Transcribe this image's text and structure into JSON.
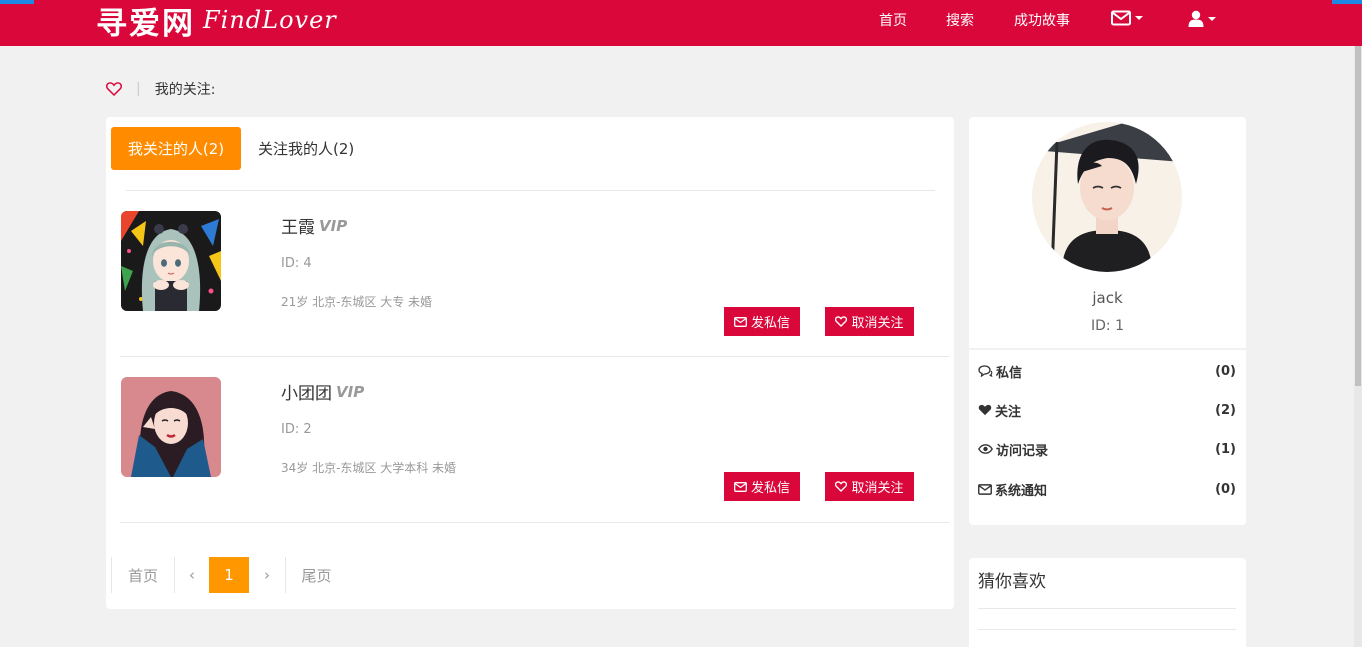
{
  "header": {
    "logo_cn": "寻爱网",
    "logo_en": "FindLover",
    "nav": [
      "首页",
      "搜索",
      "成功故事"
    ],
    "icons": [
      "envelope-icon",
      "user-icon"
    ]
  },
  "breadcrumb": {
    "label": "我的关注:"
  },
  "tabs": {
    "active": "我关注的人(2)",
    "other": "关注我的人(2)"
  },
  "users": [
    {
      "name": "王霞",
      "vip": "VIP",
      "id": "ID: 4",
      "info": "21岁 北京-东城区 大专 未婚",
      "message_btn": "发私信",
      "unfollow_btn": "取消关注"
    },
    {
      "name": "小团团",
      "vip": "VIP",
      "id": "ID: 2",
      "info": "34岁 北京-东城区 大学本科 未婚",
      "message_btn": "发私信",
      "unfollow_btn": "取消关注"
    }
  ],
  "pager": {
    "first": "首页",
    "prev": "‹",
    "current": "1",
    "next": "›",
    "last": "尾页"
  },
  "profile": {
    "username": "jack",
    "id": "ID: 1"
  },
  "stats": [
    {
      "label": "私信",
      "count": "(0)",
      "icon": "comments-icon"
    },
    {
      "label": "关注",
      "count": "(2)",
      "icon": "heart-icon"
    },
    {
      "label": "访问记录",
      "count": "(1)",
      "icon": "eye-icon"
    },
    {
      "label": "系统通知",
      "count": "(0)",
      "icon": "envelope-icon"
    }
  ],
  "guess": {
    "title": "猜你喜欢"
  },
  "colors": {
    "brand": "#d9073a",
    "accent": "#ff8c00",
    "page": "#f1f1f1"
  }
}
